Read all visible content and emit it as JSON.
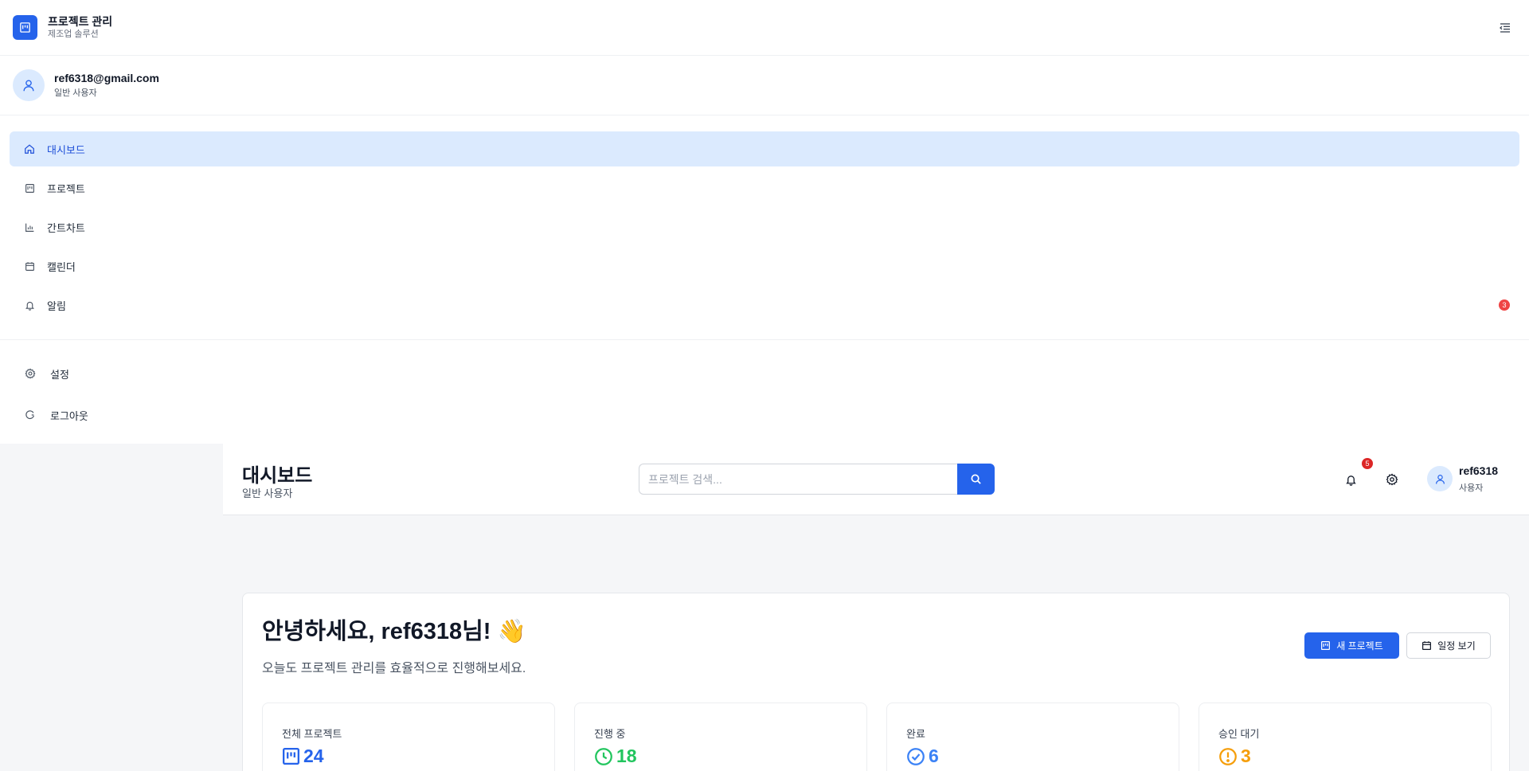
{
  "brand": {
    "title": "프로젝트 관리",
    "subtitle": "제조업 솔루션"
  },
  "user": {
    "email": "ref6318@gmail.com",
    "role": "일반 사용자"
  },
  "nav": {
    "items": [
      {
        "label": "대시보드",
        "icon": "home-icon",
        "active": true
      },
      {
        "label": "프로젝트",
        "icon": "kanban-icon"
      },
      {
        "label": "간트차트",
        "icon": "bar-chart-icon"
      },
      {
        "label": "캘린더",
        "icon": "calendar-icon"
      },
      {
        "label": "알림",
        "icon": "bell-icon",
        "badge": "3"
      }
    ],
    "bottom": [
      {
        "label": "설정",
        "icon": "gear-icon"
      },
      {
        "label": "로그아웃",
        "icon": "logout-icon"
      }
    ]
  },
  "header": {
    "title": "대시보드",
    "subtitle": "일반 사용자",
    "search_placeholder": "프로젝트 검색...",
    "notification_count": "5",
    "user_name": "ref6318",
    "user_role": "사용자"
  },
  "welcome": {
    "greeting": "안녕하세요, ref6318님! 👋",
    "subtitle": "오늘도 프로젝트 관리를 효율적으로 진행해보세요.",
    "new_project_label": "새 프로젝트",
    "view_schedule_label": "일정 보기"
  },
  "stats": [
    {
      "label": "전체 프로젝트",
      "value": "24",
      "color": "#2563eb",
      "icon": "kanban-icon"
    },
    {
      "label": "진행 중",
      "value": "18",
      "color": "#22c55e",
      "icon": "clock-icon"
    },
    {
      "label": "완료",
      "value": "6",
      "color": "#3b82f6",
      "icon": "check-circle-icon"
    },
    {
      "label": "승인 대기",
      "value": "3",
      "color": "#f59e0b",
      "icon": "alert-circle-icon"
    }
  ],
  "colors": {
    "accent": "#2563eb",
    "active_bg": "#dbeafe",
    "badge": "#ef4444"
  }
}
